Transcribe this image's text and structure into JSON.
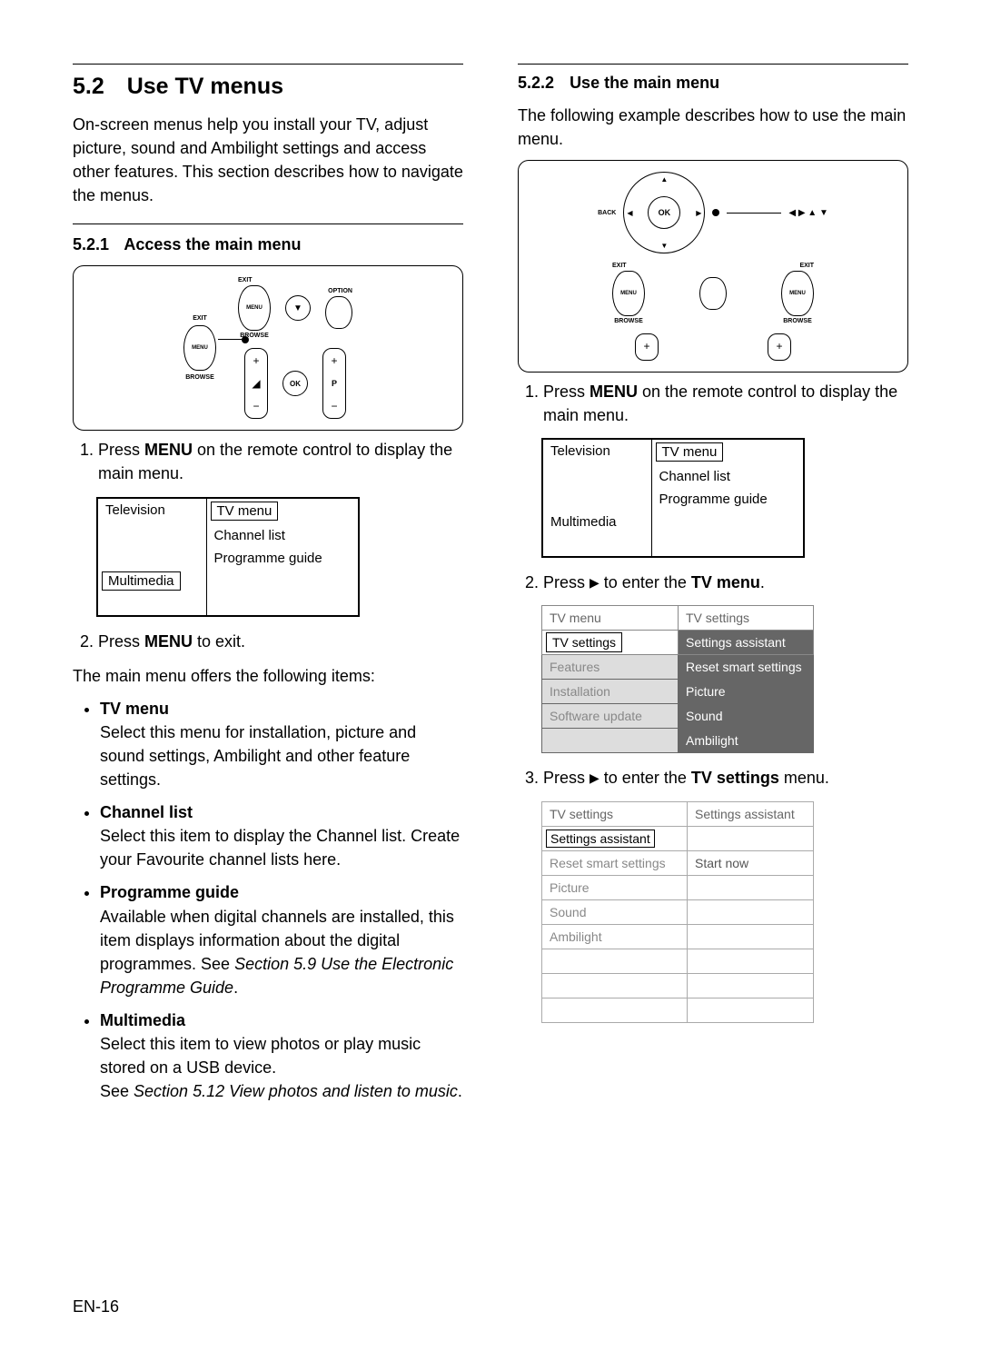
{
  "left": {
    "sec_num": "5.2",
    "sec_title": "Use TV menus",
    "intro": "On-screen menus help you install your TV, adjust picture, sound and Ambilight settings and access other features. This section describes how to navigate the menus.",
    "sub1_num": "5.2.1",
    "sub1_title": "Access the main menu",
    "remote1": {
      "exit": "EXIT",
      "menu": "MENU",
      "browse": "BROWSE",
      "option": "OPTION",
      "ok": "OK",
      "plus": "+",
      "minus": "−",
      "p": "P",
      "mute": "◢"
    },
    "step1_pre": "Press ",
    "step1_bold": "MENU",
    "step1_post": " on the remote control to display the main menu.",
    "tbl1": {
      "television": "Television",
      "tv_menu": "TV menu",
      "channel_list": "Channel list",
      "programme_guide": "Programme guide",
      "multimedia": "Multimedia"
    },
    "step2_pre": "Press ",
    "step2_bold": "MENU",
    "step2_post": " to exit.",
    "offers": "The main menu offers the following items:",
    "items": {
      "i1_t": "TV menu",
      "i1_d": "Select this menu for installation, picture and sound settings, Ambilight and other feature settings.",
      "i2_t": "Channel list",
      "i2_d": "Select this item to display the Channel list. Create your Favourite channel lists here.",
      "i3_t": "Programme guide",
      "i3_d1": "Available when digital channels are installed, this item displays information about the digital programmes. See ",
      "i3_ref": "Section 5.9 Use the Electronic Programme Guide",
      "i3_d2": ".",
      "i4_t": "Multimedia",
      "i4_d1": "Select this item to view photos or play music stored on a USB device.",
      "i4_d2": "See ",
      "i4_ref": "Section 5.12 View photos and listen to music",
      "i4_d3": "."
    }
  },
  "right": {
    "sub2_num": "5.2.2",
    "sub2_title": "Use the main menu",
    "intro": "The following example describes how to use the main menu.",
    "remote2": {
      "back": "BACK",
      "ok": "OK",
      "exit": "EXIT",
      "menu": "MENU",
      "browse": "BROWSE",
      "plus": "+",
      "arrows": "◀ ▶ ▲ ▼"
    },
    "step1_pre": "Press ",
    "step1_bold": "MENU",
    "step1_post": " on the remote control to display the main menu.",
    "tbl1": {
      "television": "Television",
      "tv_menu": "TV menu",
      "channel_list": "Channel list",
      "programme_guide": "Programme guide",
      "multimedia": "Multimedia"
    },
    "step2_pre": "Press ",
    "step2_tri": "▶",
    "step2_post1": " to enter the ",
    "step2_bold": "TV menu",
    "step2_post2": ".",
    "tbl2": {
      "h1": "TV menu",
      "h2": "TV settings",
      "r1a": "TV settings",
      "r1b": "Settings assistant",
      "r2a": "Features",
      "r2b": "Reset smart settings",
      "r3a": "Installation",
      "r3b": "Picture",
      "r4a": "Software update",
      "r4b": "Sound",
      "r5b": "Ambilight"
    },
    "step3_pre": "Press ",
    "step3_tri": "▶",
    "step3_post1": " to enter the ",
    "step3_bold": "TV settings",
    "step3_post2": " menu.",
    "tbl3": {
      "h1": "TV settings",
      "h2": "Settings assistant",
      "r1a": "Settings assistant",
      "r2a": "Reset smart settings",
      "r2b": "Start now",
      "r3a": "Picture",
      "r4a": "Sound",
      "r5a": "Ambilight"
    }
  },
  "footer": "EN-16"
}
